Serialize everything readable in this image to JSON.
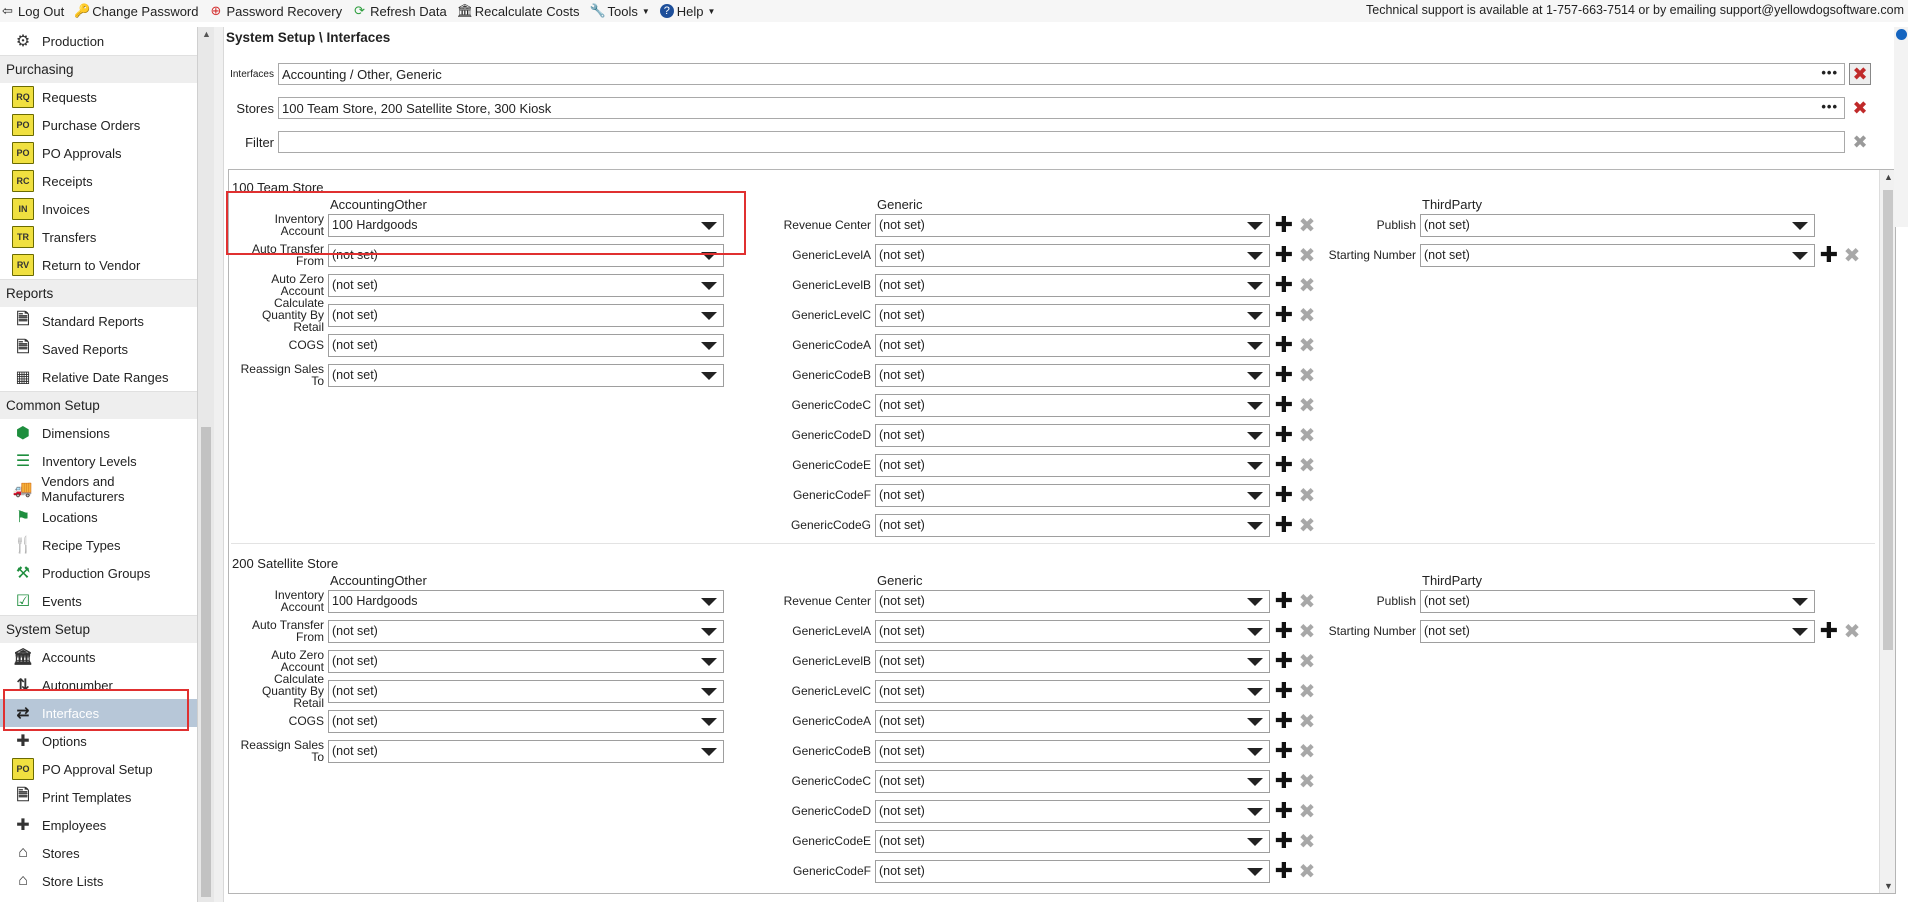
{
  "toolbar": {
    "items": [
      {
        "label": "Log Out",
        "icon": "logout-icon"
      },
      {
        "label": "Change Password",
        "icon": "key-icon"
      },
      {
        "label": "Password Recovery",
        "icon": "lifebuoy-icon"
      },
      {
        "label": "Refresh Data",
        "icon": "refresh-icon"
      },
      {
        "label": "Recalculate Costs",
        "icon": "bank-icon"
      },
      {
        "label": "Tools",
        "icon": "wrench-icon"
      },
      {
        "label": "Help",
        "icon": "help-icon"
      }
    ],
    "support": "Technical support is available at 1-757-663-7514 or by emailing support@yellowdogsoftware.com"
  },
  "sidebar": {
    "sections": [
      {
        "header": null,
        "items": [
          {
            "label": "Production",
            "icon": "production-icon"
          }
        ]
      },
      {
        "header": "Purchasing",
        "items": [
          {
            "label": "Requests",
            "icon": "rq-icon",
            "code": "RQ"
          },
          {
            "label": "Purchase Orders",
            "icon": "po-icon",
            "code": "PO"
          },
          {
            "label": "PO Approvals",
            "icon": "po-approvals-icon",
            "code": "PO"
          },
          {
            "label": "Receipts",
            "icon": "rc-icon",
            "code": "RC"
          },
          {
            "label": "Invoices",
            "icon": "in-icon",
            "code": "IN"
          },
          {
            "label": "Transfers",
            "icon": "tr-icon",
            "code": "TR"
          },
          {
            "label": "Return to Vendor",
            "icon": "rv-icon",
            "code": "RV"
          }
        ]
      },
      {
        "header": "Reports",
        "items": [
          {
            "label": "Standard Reports",
            "icon": "document-icon"
          },
          {
            "label": "Saved Reports",
            "icon": "saved-report-icon"
          },
          {
            "label": "Relative Date Ranges",
            "icon": "calendar-icon"
          }
        ]
      },
      {
        "header": "Common Setup",
        "items": [
          {
            "label": "Dimensions",
            "icon": "cube-icon"
          },
          {
            "label": "Inventory Levels",
            "icon": "levels-icon"
          },
          {
            "label": "Vendors and Manufacturers",
            "icon": "truck-icon"
          },
          {
            "label": "Locations",
            "icon": "flag-icon"
          },
          {
            "label": "Recipe Types",
            "icon": "fork-knife-icon"
          },
          {
            "label": "Production Groups",
            "icon": "hammer-icon"
          },
          {
            "label": "Events",
            "icon": "calendar-check-icon"
          }
        ]
      },
      {
        "header": "System Setup",
        "items": [
          {
            "label": "Accounts",
            "icon": "bank-icon"
          },
          {
            "label": "Autonumber",
            "icon": "sort-numeric-icon"
          },
          {
            "label": "Interfaces",
            "icon": "arrows-exchange-icon",
            "selected": true
          },
          {
            "label": "Options",
            "icon": "plus-icon"
          },
          {
            "label": "PO Approval Setup",
            "icon": "po-icon",
            "code": "PO"
          },
          {
            "label": "Print Templates",
            "icon": "document-icon"
          },
          {
            "label": "Employees",
            "icon": "plus-icon"
          },
          {
            "label": "Stores",
            "icon": "store-icon"
          },
          {
            "label": "Store Lists",
            "icon": "store-list-icon"
          }
        ]
      }
    ]
  },
  "main": {
    "title": "System Setup \\ Interfaces",
    "filters": {
      "interfaces_label": "Interfaces",
      "interfaces_value": "Accounting / Other, Generic",
      "stores_label": "Stores",
      "stores_value": "100 Team Store, 200 Satellite Store, 300 Kiosk",
      "filter_label": "Filter",
      "filter_value": ""
    },
    "stores": [
      {
        "name": "100 Team Store",
        "accounting_header": "AccountingOther",
        "generic_header": "Generic",
        "third_header": "ThirdParty",
        "accounting": [
          {
            "label": "Inventory Account",
            "value": "100 Hardgoods"
          },
          {
            "label": "Auto Transfer From",
            "value": "(not set)"
          },
          {
            "label": "Auto Zero Account",
            "value": "(not set)"
          },
          {
            "label": "Calculate Quantity By Retail",
            "value": "(not set)"
          },
          {
            "label": "COGS",
            "value": "(not set)"
          },
          {
            "label": "Reassign Sales To",
            "value": "(not set)"
          }
        ],
        "generic": [
          {
            "label": "Revenue Center",
            "value": "(not set)"
          },
          {
            "label": "GenericLevelA",
            "value": "(not set)"
          },
          {
            "label": "GenericLevelB",
            "value": "(not set)"
          },
          {
            "label": "GenericLevelC",
            "value": "(not set)"
          },
          {
            "label": "GenericCodeA",
            "value": "(not set)"
          },
          {
            "label": "GenericCodeB",
            "value": "(not set)"
          },
          {
            "label": "GenericCodeC",
            "value": "(not set)"
          },
          {
            "label": "GenericCodeD",
            "value": "(not set)"
          },
          {
            "label": "GenericCodeE",
            "value": "(not set)"
          },
          {
            "label": "GenericCodeF",
            "value": "(not set)"
          },
          {
            "label": "GenericCodeG",
            "value": "(not set)"
          }
        ],
        "third": [
          {
            "label": "Publish",
            "value": "(not set)"
          },
          {
            "label": "Starting Number",
            "value": "(not set)"
          }
        ]
      },
      {
        "name": "200 Satellite Store",
        "accounting_header": "AccountingOther",
        "generic_header": "Generic",
        "third_header": "ThirdParty",
        "accounting": [
          {
            "label": "Inventory Account",
            "value": "100 Hardgoods"
          },
          {
            "label": "Auto Transfer From",
            "value": "(not set)"
          },
          {
            "label": "Auto Zero Account",
            "value": "(not set)"
          },
          {
            "label": "Calculate Quantity By Retail",
            "value": "(not set)"
          },
          {
            "label": "COGS",
            "value": "(not set)"
          },
          {
            "label": "Reassign Sales To",
            "value": "(not set)"
          }
        ],
        "generic": [
          {
            "label": "Revenue Center",
            "value": "(not set)"
          },
          {
            "label": "GenericLevelA",
            "value": "(not set)"
          },
          {
            "label": "GenericLevelB",
            "value": "(not set)"
          },
          {
            "label": "GenericLevelC",
            "value": "(not set)"
          },
          {
            "label": "GenericCodeA",
            "value": "(not set)"
          },
          {
            "label": "GenericCodeB",
            "value": "(not set)"
          },
          {
            "label": "GenericCodeC",
            "value": "(not set)"
          },
          {
            "label": "GenericCodeD",
            "value": "(not set)"
          },
          {
            "label": "GenericCodeE",
            "value": "(not set)"
          },
          {
            "label": "GenericCodeF",
            "value": "(not set)"
          }
        ],
        "third": [
          {
            "label": "Publish",
            "value": "(not set)"
          },
          {
            "label": "Starting Number",
            "value": "(not set)"
          }
        ]
      }
    ]
  }
}
